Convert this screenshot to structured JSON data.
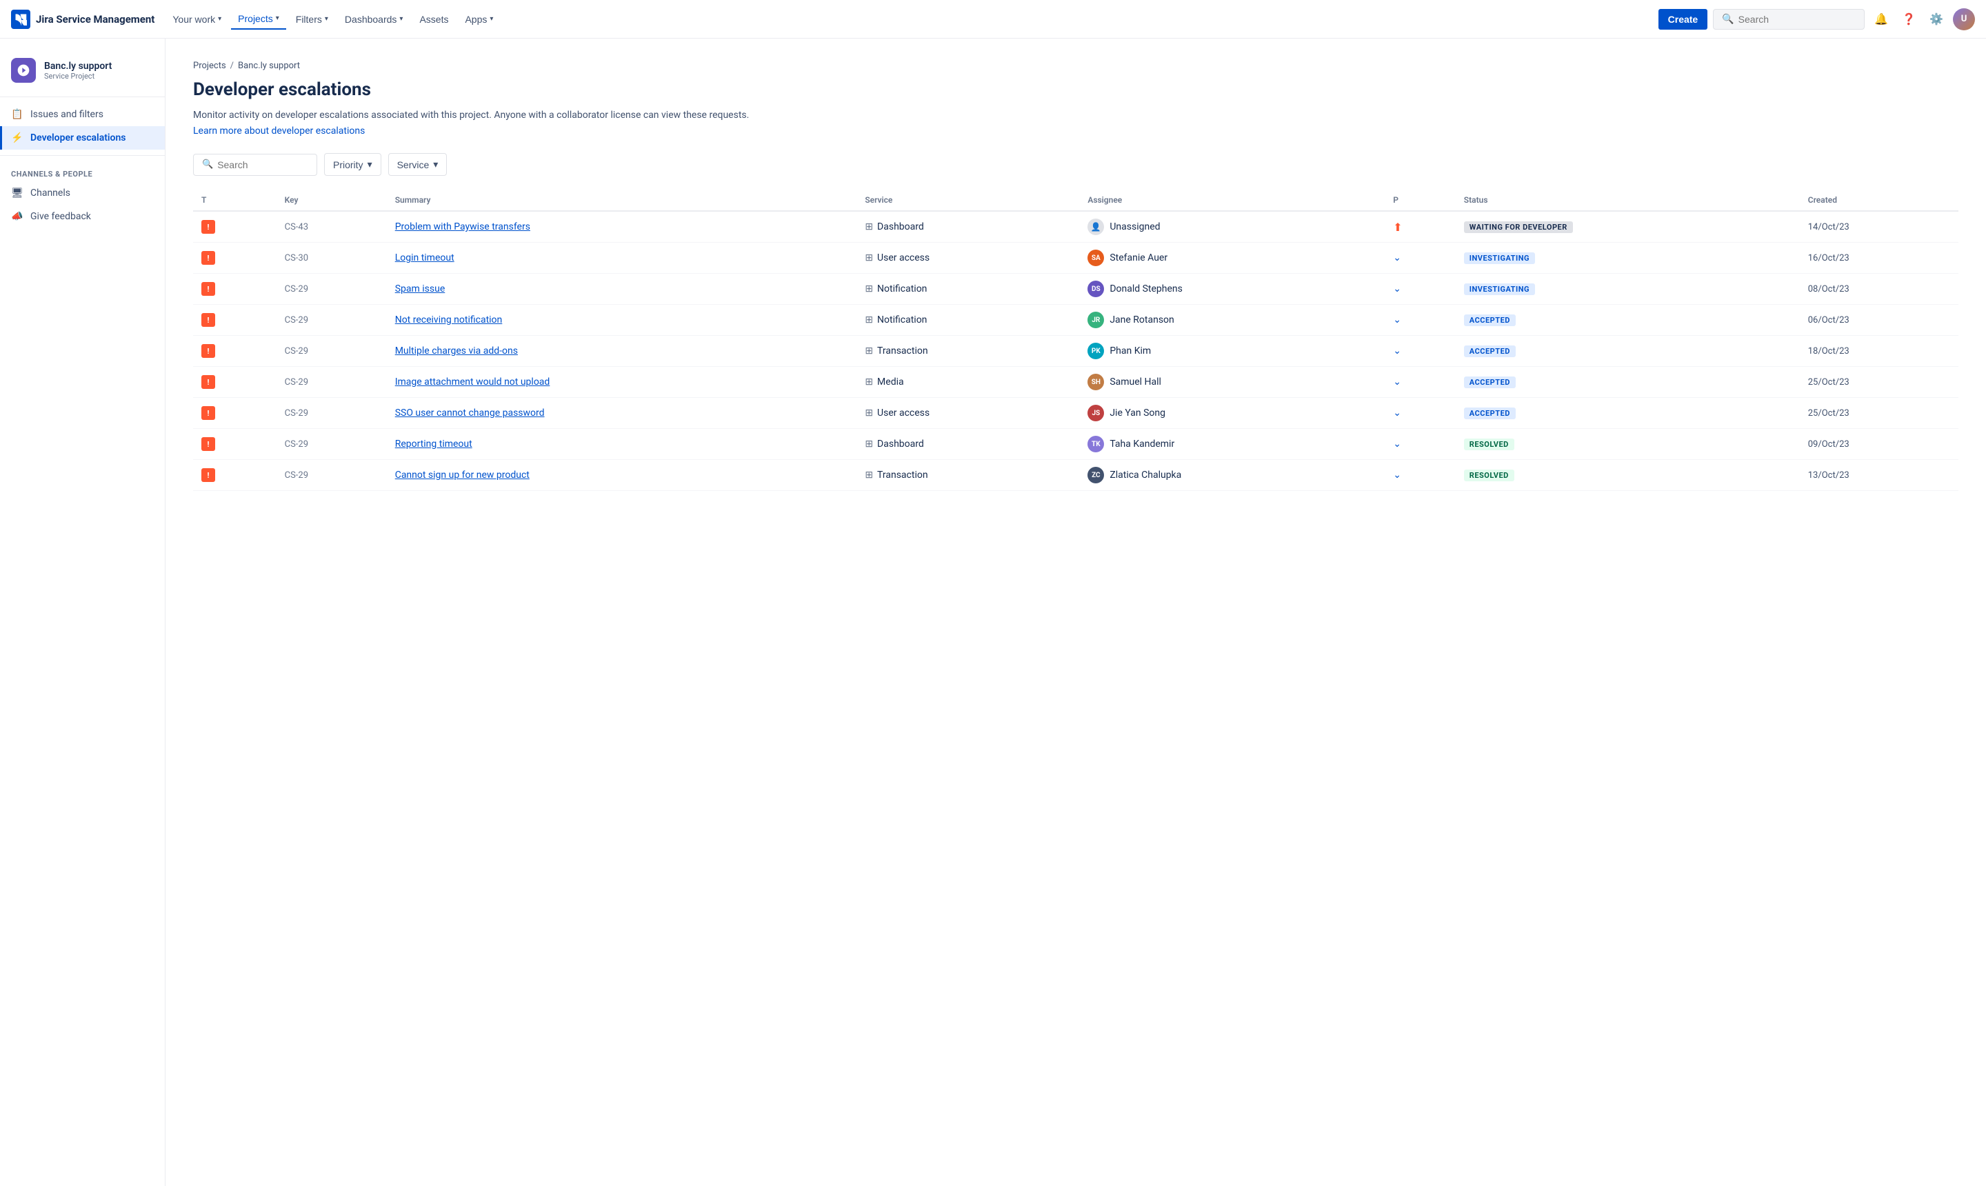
{
  "topnav": {
    "logo_text": "Jira Service Management",
    "nav_items": [
      {
        "label": "Your work",
        "has_chevron": true,
        "active": false
      },
      {
        "label": "Projects",
        "has_chevron": true,
        "active": true
      },
      {
        "label": "Filters",
        "has_chevron": true,
        "active": false
      },
      {
        "label": "Dashboards",
        "has_chevron": true,
        "active": false
      },
      {
        "label": "Assets",
        "has_chevron": false,
        "active": false
      },
      {
        "label": "Apps",
        "has_chevron": true,
        "active": false
      }
    ],
    "create_label": "Create",
    "search_placeholder": "Search",
    "icons": [
      "bell-icon",
      "help-icon",
      "settings-icon"
    ]
  },
  "sidebar": {
    "project_name": "Banc.ly support",
    "project_type": "Service Project",
    "nav_items": [
      {
        "label": "Issues and filters",
        "icon": "issues-icon",
        "active": false
      },
      {
        "label": "Developer escalations",
        "icon": "escalations-icon",
        "active": true
      }
    ],
    "section_header": "CHANNELS & PEOPLE",
    "channels_items": [
      {
        "label": "Channels",
        "icon": "channels-icon"
      },
      {
        "label": "Give feedback",
        "icon": "feedback-icon"
      }
    ]
  },
  "breadcrumb": {
    "items": [
      "Projects",
      "Banc.ly support"
    ],
    "separator": "/"
  },
  "page": {
    "title": "Developer escalations",
    "description": "Monitor activity on developer escalations associated with this project. Anyone with a collaborator license can view these requests.",
    "link_text": "Learn more about developer escalations"
  },
  "filters": {
    "search_placeholder": "Search",
    "priority_label": "Priority",
    "service_label": "Service"
  },
  "table": {
    "columns": [
      "T",
      "Key",
      "Summary",
      "Service",
      "Assignee",
      "P",
      "Status",
      "Created"
    ],
    "rows": [
      {
        "key": "CS-43",
        "summary": "Problem with Paywise transfers",
        "service": "Dashboard",
        "assignee": "Unassigned",
        "assignee_color": "",
        "assignee_initials": "",
        "priority": "high",
        "status": "WAITING FOR DEVELOPER",
        "status_class": "status-waiting",
        "created": "14/Oct/23"
      },
      {
        "key": "CS-30",
        "summary": "Login timeout",
        "service": "User access",
        "assignee": "Stefanie Auer",
        "assignee_color": "#e65c1c",
        "assignee_initials": "SA",
        "priority": "low",
        "status": "INVESTIGATING",
        "status_class": "status-investigating",
        "created": "16/Oct/23"
      },
      {
        "key": "CS-29",
        "summary": "Spam issue",
        "service": "Notification",
        "assignee": "Donald Stephens",
        "assignee_color": "#6554c0",
        "assignee_initials": "DS",
        "priority": "low",
        "status": "INVESTIGATING",
        "status_class": "status-investigating",
        "created": "08/Oct/23"
      },
      {
        "key": "CS-29",
        "summary": "Not receiving notification",
        "service": "Notification",
        "assignee": "Jane Rotanson",
        "assignee_color": "#36b37e",
        "assignee_initials": "JR",
        "priority": "low",
        "status": "ACCEPTED",
        "status_class": "status-accepted",
        "created": "06/Oct/23"
      },
      {
        "key": "CS-29",
        "summary": "Multiple charges via add-ons",
        "service": "Transaction",
        "assignee": "Phan Kim",
        "assignee_color": "#00a3bf",
        "assignee_initials": "PK",
        "priority": "low",
        "status": "ACCEPTED",
        "status_class": "status-accepted",
        "created": "18/Oct/23"
      },
      {
        "key": "CS-29",
        "summary": "Image attachment would not upload",
        "service": "Media",
        "assignee": "Samuel Hall",
        "assignee_color": "#c17c44",
        "assignee_initials": "SH",
        "priority": "low",
        "status": "ACCEPTED",
        "status_class": "status-accepted",
        "created": "25/Oct/23"
      },
      {
        "key": "CS-29",
        "summary": "SSO user cannot change password",
        "service": "User access",
        "assignee": "Jie Yan Song",
        "assignee_color": "#bf4040",
        "assignee_initials": "JS",
        "priority": "low",
        "status": "ACCEPTED",
        "status_class": "status-accepted",
        "created": "25/Oct/23"
      },
      {
        "key": "CS-29",
        "summary": "Reporting timeout",
        "service": "Dashboard",
        "assignee": "Taha Kandemir",
        "assignee_color": "#8777d9",
        "assignee_initials": "TK",
        "priority": "low",
        "status": "RESOLVED",
        "status_class": "status-resolved",
        "created": "09/Oct/23"
      },
      {
        "key": "CS-29",
        "summary": "Cannot sign up for new product",
        "service": "Transaction",
        "assignee": "Zlatica Chalupka",
        "assignee_color": "#42526e",
        "assignee_initials": "ZC",
        "priority": "low",
        "status": "RESOLVED",
        "status_class": "status-resolved",
        "created": "13/Oct/23"
      }
    ]
  }
}
